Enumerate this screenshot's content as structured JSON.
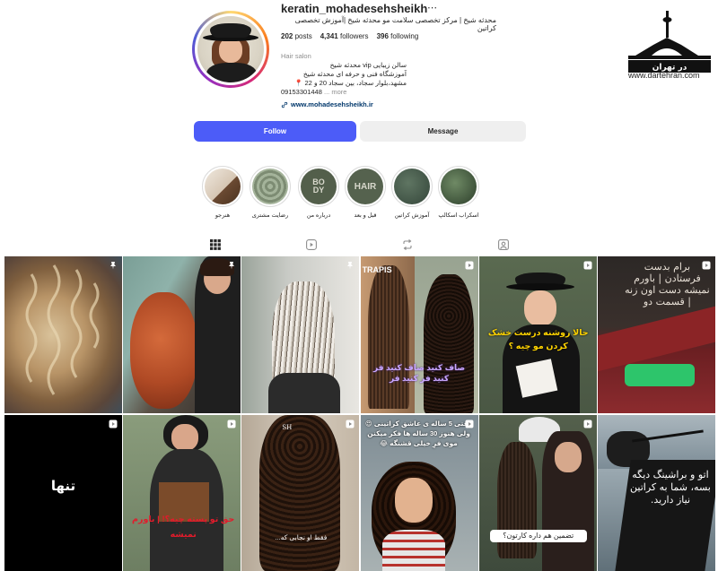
{
  "profile": {
    "username": "keratin_mohadesehsheikh",
    "more_icon": "⋯",
    "bio_top": "محدثه شیخ | مرکز تخصصی سلامت مو محدثه شیخ |آموزش تخصصی کراتین",
    "stats": {
      "posts_count": "202",
      "posts_label": "posts",
      "followers_count": "4,341",
      "followers_label": "followers",
      "following_count": "396",
      "following_label": "following"
    },
    "category": "Hair salon",
    "bio_lines": [
      "سالن زیبایی vip محدثه شیخ",
      "آموزشگاه فنی و حرفه ای محدثه شیخ",
      "مشهد،بلوار سجاد، بین سجاد 20 و 22 📍"
    ],
    "phone": "09153301448",
    "more_label": "... more",
    "website": "www.mohadesehsheikh.ir"
  },
  "buttons": {
    "follow": "Follow",
    "message": "Message"
  },
  "watermark": {
    "text": "www.dartehran.com",
    "logo_label": "در تهران"
  },
  "highlights": [
    {
      "label": "اسکراب اسکالپ",
      "color": "#3e5b3a"
    },
    {
      "label": "آموزش کراتین",
      "color": "#4a5d4c"
    },
    {
      "label": "قبل و بعد",
      "color": "#5d6a56",
      "text": "HAIR"
    },
    {
      "label": "درباره من",
      "color": "#5a6650",
      "text": "BO DY"
    },
    {
      "label": "رضایت مشتری",
      "color": "#8a9a80"
    },
    {
      "label": "هنرجو",
      "color": "#d9cfc2"
    }
  ],
  "tabs": [
    "posts-tab",
    "reels-tab",
    "reposts-tab",
    "tagged-tab"
  ],
  "posts": [
    {
      "kind": "pin",
      "overlay": ""
    },
    {
      "kind": "pin",
      "overlay": ""
    },
    {
      "kind": "pin",
      "overlay": ""
    },
    {
      "kind": "reel",
      "overlay": "صاف کنید صاف کنید فر کنید فر کنید فر"
    },
    {
      "kind": "reel",
      "overlay": "حالا روشنه درست خشک کردن مو چیه ؟"
    },
    {
      "kind": "reel",
      "overlay": "برام بدست فرستادن | باورم نمیشه دست اون زنه | قسمت دو"
    },
    {
      "kind": "reel",
      "overlay": "تنها"
    },
    {
      "kind": "reel",
      "overlay": "حق تو پسته چیه؟! | باورم نمیشه"
    },
    {
      "kind": "reel",
      "overlay": "فقط او نجابی که..."
    },
    {
      "kind": "reel",
      "overlay": "وقتی 5 ساله ی عاشق کراتینی 😍 ولی هنوز 30 ساله ها فکر میکنن موی فرِ خیلی قشنگه 😂"
    },
    {
      "kind": "reel",
      "overlay": "تضمین هم داره کارتون؟"
    },
    {
      "kind": "none",
      "overlay": "اتو و براشینگ دیگه بسه، شما به کراتین نیاز دارید."
    }
  ]
}
